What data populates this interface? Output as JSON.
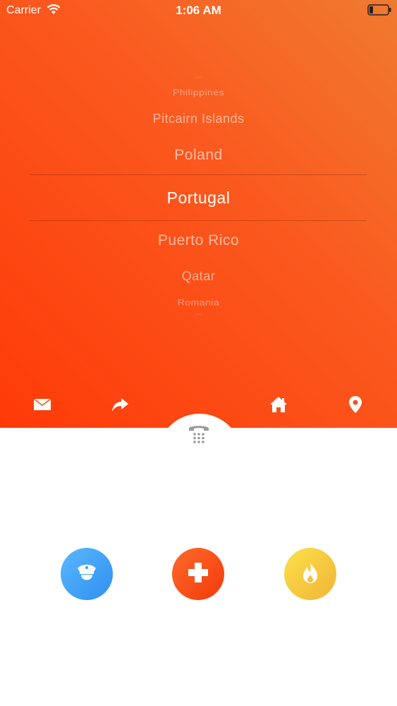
{
  "status_bar": {
    "carrier": "Carrier",
    "time": "1:06 AM"
  },
  "picker": {
    "items": [
      "Philippines",
      "Pitcairn Islands",
      "Poland",
      "Portugal",
      "Puerto Rico",
      "Qatar",
      "Romania"
    ],
    "selected": "Portugal"
  },
  "icons": {
    "mail": "mail-icon",
    "share": "share-icon",
    "home": "home-icon",
    "location": "location-pin-icon",
    "dialpad": "telephone-dialpad-icon",
    "police": "police-officer-icon",
    "medical": "medical-cross-icon",
    "fire": "fire-icon"
  },
  "colors": {
    "top_gradient_start": "#ff3a08",
    "top_gradient_end": "#f07a30",
    "police": "#3a9cf5",
    "medical": "#f5480f",
    "fire": "#f6c83f"
  }
}
